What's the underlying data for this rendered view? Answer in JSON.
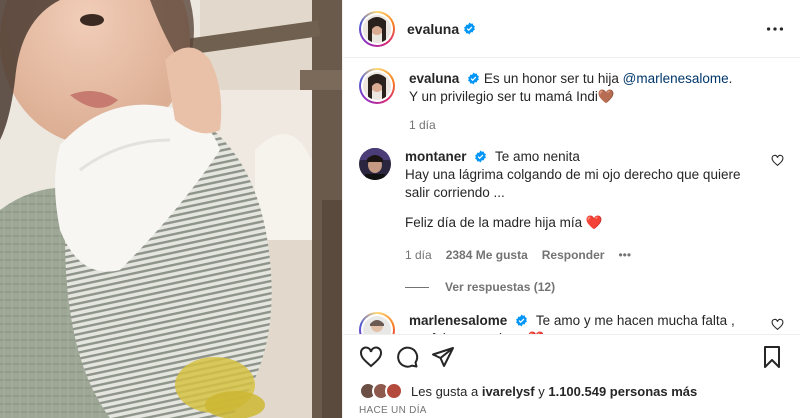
{
  "post": {
    "author": "evaluna",
    "caption_author": "evaluna",
    "caption_text_1": "Es un honor ser tu hija ",
    "caption_mention": "@marlenesalome",
    "caption_text_2": ".",
    "caption_line2": "Y un privilegio ser tu mamá Indi",
    "caption_emoji": "🤎",
    "caption_time": "1 día"
  },
  "comments": [
    {
      "user": "montaner",
      "text_line1": "Te amo nenita",
      "text_line2": "Hay una lágrima colgando de mi ojo derecho que quiere salir corriendo ...",
      "text_line3": "Feliz día de la madre hija mía",
      "emoji": "❤️",
      "time": "1 día",
      "likes": "2384 Me gusta",
      "reply": "Responder",
      "more": "•••",
      "view_replies": "Ver respuestas (12)"
    },
    {
      "user": "marlenesalome",
      "text": "Te amo y me hacen mucha falta , me falta un pedazo",
      "emoji": "❤️"
    }
  ],
  "footer": {
    "likes_prefix": "Les gusta a ",
    "likes_user": "ivarelysf",
    "likes_mid": " y ",
    "likes_count": "1.100.549 personas más",
    "timestamp": "HACE UN DÍA"
  },
  "icons": {
    "more": "more-horizontal-icon",
    "like": "heart-icon",
    "comment": "comment-icon",
    "share": "send-icon",
    "save": "bookmark-icon",
    "verified": "verified-badge-icon"
  },
  "colors": {
    "verified": "#0095f6",
    "heart_red": "#e0245e",
    "brown_heart": "#7b4a2a",
    "muted": "#737373",
    "link": "#00376b"
  }
}
